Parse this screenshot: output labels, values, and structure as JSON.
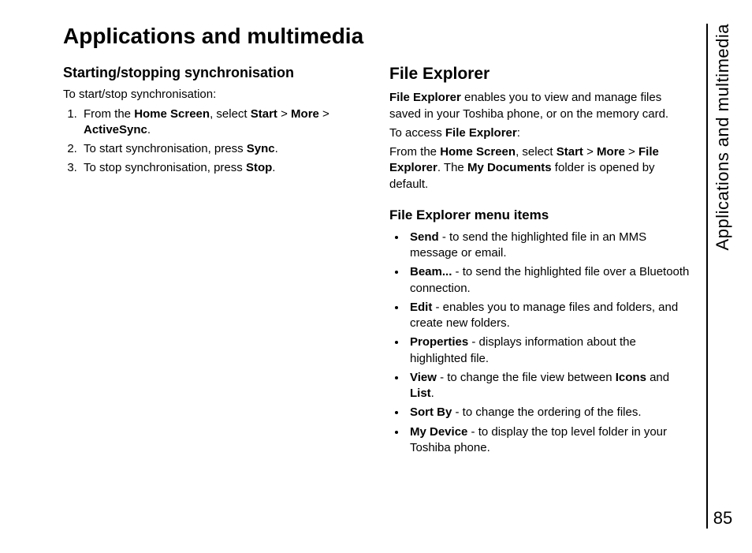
{
  "title": "Applications and multimedia",
  "sidebar_label": "Applications and multimedia",
  "page_number": "85",
  "left": {
    "heading": "Starting/stopping synchronisation",
    "intro": "To start/stop synchronisation:",
    "steps_html": [
      "From the <b>Home Screen</b>, select <b>Start</b> > <b>More</b> > <b>ActiveSync</b>.",
      "To start synchronisation, press <b>Sync</b>.",
      "To stop synchronisation, press <b>Stop</b>."
    ]
  },
  "right": {
    "heading": "File Explorer",
    "intro_html": "<b>File Explorer</b> enables you to view and manage files saved in your Toshiba phone, or on the memory card.",
    "access_label_html": "To access <b>File Explorer</b>:",
    "access_body_html": "From the <b>Home Screen</b>, select <b>Start</b> > <b>More</b> > <b>File Explorer</b>. The <b>My Documents</b> folder is opened by default.",
    "menu_heading": "File Explorer menu items",
    "menu_items_html": [
      "<b>Send</b> - to send the highlighted file in an MMS message or email.",
      "<b>Beam...</b> - to send the highlighted file over a Bluetooth connection.",
      "<b>Edit</b> - enables you to manage files and folders, and create new folders.",
      "<b>Properties</b> - displays information about the highlighted file.",
      "<b>View</b> - to change the file view between <b>Icons</b> and <b>List</b>.",
      "<b>Sort By</b> - to change the ordering of the files.",
      "<b>My Device</b> - to display the top level folder in your Toshiba phone."
    ]
  }
}
